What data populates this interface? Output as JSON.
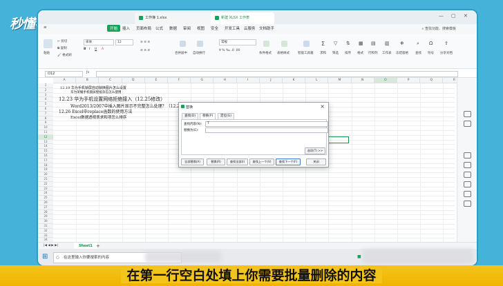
{
  "watermark": {
    "logo": "秒懂视频"
  },
  "titlebar": {
    "tab_file": "工作簿 1.xlsx",
    "tab_active": "新建 XLSX 工作表"
  },
  "menu": {
    "items": [
      "开始",
      "插入",
      "页面布局",
      "公式",
      "数据",
      "审阅",
      "视图",
      "安全",
      "开发工具",
      "云服务",
      "文档助手"
    ],
    "search": "查找功能、搜索模板"
  },
  "toolbar": {
    "paste": "粘贴",
    "cut": "剪切",
    "copy": "复制",
    "format_painter": "格式刷",
    "font_name": "宋体",
    "font_size": "12",
    "merge_center": "合并居中",
    "wrap": "自动换行",
    "number_format": "常规",
    "cond_format": "条件格式",
    "table_style": "表格样式",
    "smart_toolbox": "智能工具箱",
    "sum": "求和",
    "filter": "筛选",
    "sort": "排序",
    "format": "格式",
    "row_col": "行和列",
    "worksheet": "工作表",
    "freeze": "冻结窗格",
    "find": "查找",
    "symbol": "符号",
    "share": "分享文档"
  },
  "formula_bar": {
    "cell_ref": "O12"
  },
  "grid": {
    "columns": [
      "A",
      "B",
      "C",
      "D",
      "E",
      "F",
      "G",
      "H",
      "I",
      "J",
      "K",
      "L",
      "M",
      "N",
      "O",
      "P",
      "Q",
      "R"
    ],
    "rows": [
      "1",
      "2",
      "3",
      "4",
      "5",
      "6",
      "7",
      "8",
      "9",
      "10",
      "11",
      "12",
      "13",
      "14",
      "15",
      "16",
      "17",
      "18",
      "19",
      "20",
      "21",
      "22",
      "23",
      "24",
      "25",
      "26",
      "27",
      "28",
      "29",
      "30",
      "31",
      "32",
      "33",
      "34"
    ],
    "lines": [
      "12.19 华为手机锁屏自动锁换图片怎么设置",
      "华为荣耀手机锁屏壁纸杂志怎么使用",
      "12.23 华为手机设置网络拒绝接入（12.25修改）",
      "Word2013/2007中插入图片显示不完整怎么处理？（12.25修改",
      "12.26 Excel中replace函数的使用方法",
      "Excel数据透视表求和项怎么排序"
    ]
  },
  "dialog": {
    "title": "替换",
    "tabs": [
      "查找(D)",
      "替换(P)",
      "定位(G)"
    ],
    "find_label": "查找内容(N):",
    "find_value": "T",
    "replace_label": "替换为(E):",
    "replace_value": "",
    "options_button": "选项(T) >>",
    "buttons": [
      "全部替换(A)",
      "替换(R)",
      "查找全部(I)",
      "查找上一个(V)",
      "查找下一个(F)",
      "关闭"
    ]
  },
  "sheet": {
    "tab": "Sheet1",
    "add": "+"
  },
  "taskbar": {
    "search_placeholder": "在这里输入你要搜索的内容"
  },
  "subtitle": "在第一行空白处填上你需要批量删除的内容"
}
